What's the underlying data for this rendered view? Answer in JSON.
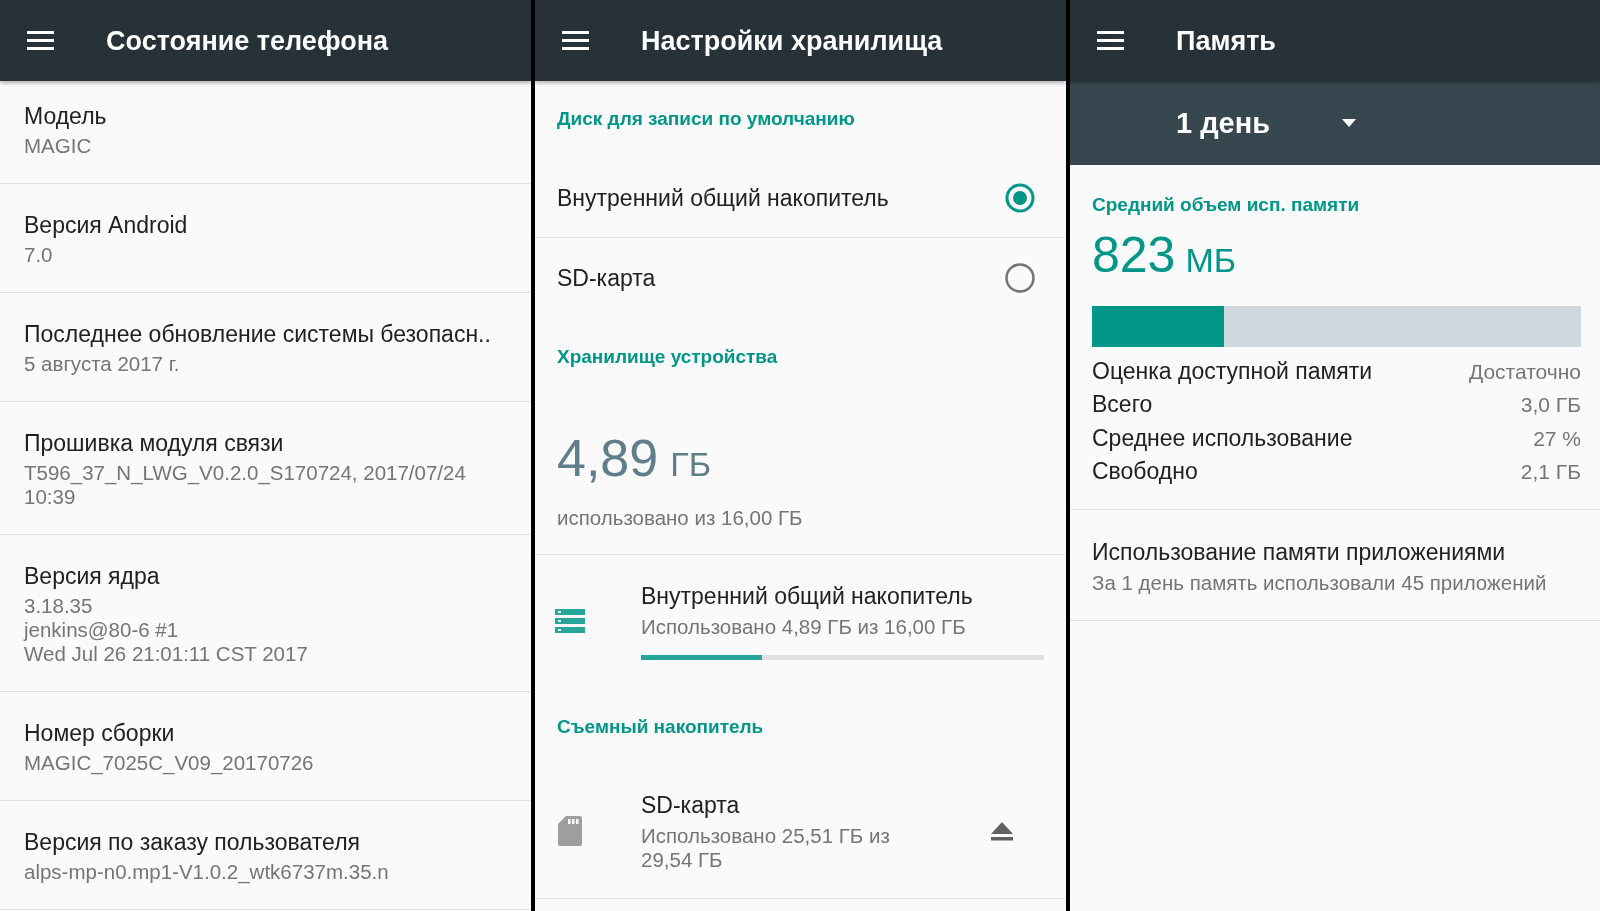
{
  "screens": [
    {
      "kind": "info_list",
      "title": "Состояние телефона",
      "items": [
        {
          "label": "Модель",
          "value": "MAGIC"
        },
        {
          "label": "Версия Android",
          "value": "7.0"
        },
        {
          "label": "Последнее обновление системы безопасн..",
          "value": "5 августа 2017 г."
        },
        {
          "label": "Прошивка модуля связи",
          "value": "T596_37_N_LWG_V0.2.0_S170724, 2017/07/24 10:39"
        },
        {
          "label": "Версия ядра",
          "value": "3.18.35\njenkins@80-6 #1\nWed Jul 26 21:01:11 CST 2017"
        },
        {
          "label": "Номер сборки",
          "value": "MAGIC_7025C_V09_20170726"
        },
        {
          "label": "Версия по заказу пользователя",
          "value": "alps-mp-n0.mp1-V1.0.2_wtk6737m.35.n"
        }
      ]
    },
    {
      "kind": "storage_settings",
      "title": "Настройки хранилища",
      "default_disk": {
        "header": "Диск для записи по умолчанию",
        "options": [
          {
            "label": "Внутренний общий накопитель",
            "selected": true
          },
          {
            "label": "SD-карта",
            "selected": false
          }
        ]
      },
      "device_storage": {
        "header": "Хранилище устройства",
        "used": "4,89",
        "unit": "ГБ",
        "caption": "использовано из 16,00 ГБ",
        "volumes": [
          {
            "kind": "internal",
            "title": "Внутренний общий накопитель",
            "summary": "Использовано 4,89 ГБ из 16,00 ГБ",
            "level": 0.3
          }
        ]
      },
      "removable_storage": {
        "header": "Съемный накопитель",
        "volumes": [
          {
            "kind": "sd_card",
            "title": "SD-карта",
            "summary": "Использовано 25,51 ГБ из 29,54 ГБ"
          }
        ]
      }
    },
    {
      "kind": "memory",
      "title": "Память",
      "period": "1 день",
      "average": {
        "header": "Средний объем исп. памяти",
        "value": "823",
        "unit": "МБ",
        "level": 0.27
      },
      "stats": [
        {
          "label": "Оценка доступной памяти",
          "value": "Достаточно"
        },
        {
          "label": "Всего",
          "value": "3,0 ГБ"
        },
        {
          "label": "Среднее использование",
          "value": "27 %"
        },
        {
          "label": "Свободно",
          "value": "2,1 ГБ"
        }
      ],
      "app_usage": {
        "title": "Использование памяти приложениями",
        "summary": "За 1 день память использовали 45 приложений"
      }
    }
  ]
}
